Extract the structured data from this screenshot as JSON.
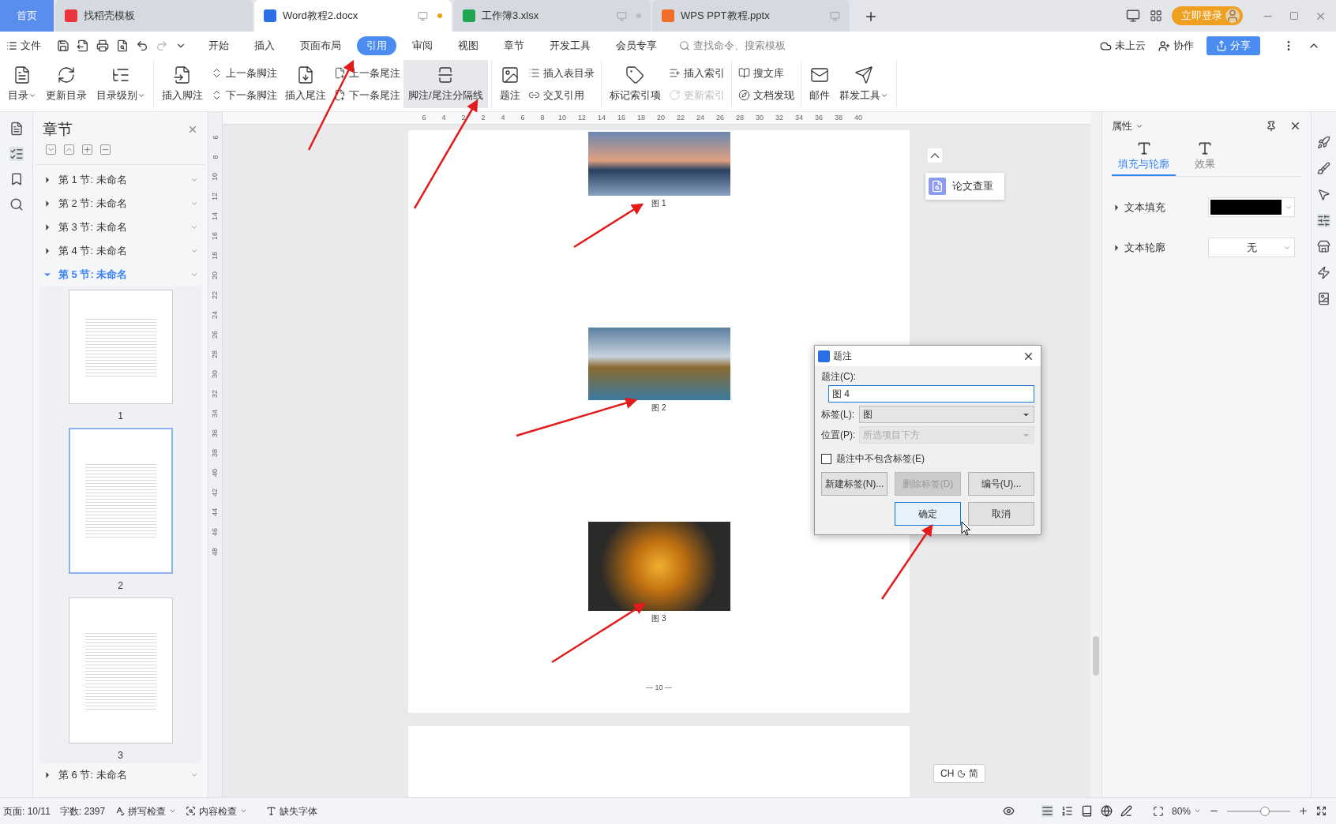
{
  "window_tabs": [
    {
      "label": "首页",
      "kind": "home",
      "selected": false
    },
    {
      "label": "找稻壳模板",
      "kind": "docer",
      "selected": false
    },
    {
      "label": "Word教程2.docx",
      "kind": "word",
      "selected": true
    },
    {
      "label": "工作簿3.xlsx",
      "kind": "excel",
      "selected": false
    },
    {
      "label": "WPS PPT教程.pptx",
      "kind": "ppt",
      "selected": false
    }
  ],
  "login_button": "立即登录",
  "menu": {
    "file": "文件",
    "search_placeholder": "查找命令、搜索模板",
    "cloud": "未上云",
    "collab": "协作",
    "share": "分享",
    "tabs": [
      {
        "label": "开始",
        "selected": false
      },
      {
        "label": "插入",
        "selected": false
      },
      {
        "label": "页面布局",
        "selected": false
      },
      {
        "label": "引用",
        "selected": true
      },
      {
        "label": "审阅",
        "selected": false
      },
      {
        "label": "视图",
        "selected": false
      },
      {
        "label": "章节",
        "selected": false
      },
      {
        "label": "开发工具",
        "selected": false
      },
      {
        "label": "会员专享",
        "selected": false
      }
    ]
  },
  "ribbon": [
    [
      {
        "kind": "large",
        "label": "目录",
        "dropdown": true,
        "highlighted": false
      },
      {
        "kind": "large",
        "label": "更新目录",
        "dropdown": false,
        "highlighted": false
      },
      {
        "kind": "large",
        "label": "目录级别",
        "dropdown": true,
        "highlighted": false
      }
    ],
    [
      {
        "kind": "large",
        "label": "插入脚注",
        "dropdown": false,
        "highlighted": false
      },
      {
        "kind": "pair",
        "items": [
          {
            "label": "上一条脚注",
            "disabled": false
          },
          {
            "label": "下一条脚注",
            "disabled": false
          }
        ]
      },
      {
        "kind": "large",
        "label": "插入尾注",
        "dropdown": false,
        "highlighted": false
      },
      {
        "kind": "pair",
        "items": [
          {
            "label": "上一条尾注",
            "disabled": false
          },
          {
            "label": "下一条尾注",
            "disabled": false
          }
        ]
      },
      {
        "kind": "large",
        "label": "脚注/尾注分隔线",
        "dropdown": false,
        "highlighted": true
      }
    ],
    [
      {
        "kind": "large",
        "label": "题注",
        "dropdown": false,
        "highlighted": false
      },
      {
        "kind": "pair",
        "items": [
          {
            "label": "插入表目录",
            "disabled": false
          },
          {
            "label": "交叉引用",
            "disabled": false
          }
        ]
      }
    ],
    [
      {
        "kind": "large",
        "label": "标记索引项",
        "dropdown": false,
        "highlighted": false
      },
      {
        "kind": "pair",
        "items": [
          {
            "label": "插入索引",
            "disabled": false
          },
          {
            "label": "更新索引",
            "disabled": true
          }
        ]
      }
    ],
    [
      {
        "kind": "pair",
        "items": [
          {
            "label": "搜文库",
            "disabled": false
          },
          {
            "label": "文档发现",
            "disabled": false
          }
        ]
      }
    ],
    [
      {
        "kind": "large",
        "label": "邮件",
        "dropdown": false,
        "highlighted": false
      },
      {
        "kind": "large",
        "label": "群发工具",
        "dropdown": true,
        "highlighted": false
      }
    ]
  ],
  "chapter_panel": {
    "title": "章节",
    "sections": [
      {
        "label": "第 1 节: 未命名",
        "expanded": false,
        "selected": false
      },
      {
        "label": "第 2 节: 未命名",
        "expanded": false,
        "selected": false
      },
      {
        "label": "第 3 节: 未命名",
        "expanded": false,
        "selected": false
      },
      {
        "label": "第 4 节: 未命名",
        "expanded": false,
        "selected": false
      },
      {
        "label": "第 5 节: 未命名",
        "expanded": true,
        "selected": true,
        "pages": [
          {
            "number": "1",
            "selected": false
          },
          {
            "number": "2",
            "selected": true
          },
          {
            "number": "3",
            "selected": false
          }
        ]
      },
      {
        "label": "第 6 节: 未命名",
        "expanded": false,
        "selected": false
      }
    ]
  },
  "rulers": {
    "horizontal": [
      "6",
      "4",
      "2",
      "2",
      "4",
      "6",
      "8",
      "10",
      "12",
      "14",
      "16",
      "18",
      "20",
      "22",
      "24",
      "26",
      "28",
      "30",
      "32",
      "34",
      "36",
      "38",
      "40"
    ],
    "vertical": [
      "6",
      "8",
      "10",
      "12",
      "14",
      "16",
      "18",
      "20",
      "22",
      "24",
      "26",
      "28",
      "30",
      "32",
      "34",
      "36",
      "38",
      "40",
      "42",
      "44",
      "46",
      "48"
    ]
  },
  "document": {
    "figures": [
      {
        "caption": "图 1"
      },
      {
        "caption": "图 2"
      },
      {
        "caption": "图 3"
      }
    ],
    "page_number": "— 10 —"
  },
  "floating_button": "论文查重",
  "ime": {
    "language": "CH",
    "mode": "简"
  },
  "properties_panel": {
    "title": "属性",
    "tabs": [
      {
        "label": "填充与轮廓",
        "selected": true
      },
      {
        "label": "效果",
        "selected": false
      }
    ],
    "rows": [
      {
        "label": "文本填充",
        "kind": "color",
        "color": "#000000"
      },
      {
        "label": "文本轮廓",
        "kind": "select",
        "value": "无"
      }
    ]
  },
  "dialog": {
    "title": "题注",
    "caption_label": "题注(C):",
    "caption_value": "图 4",
    "fields": [
      {
        "label": "标签(L):",
        "value": "图",
        "disabled": false
      },
      {
        "label": "位置(P):",
        "value": "所选项目下方",
        "disabled": true
      }
    ],
    "checkbox": {
      "label": "题注中不包含标签(E)",
      "checked": false
    },
    "buttons": [
      {
        "label": "新建标签(N)...",
        "disabled": false,
        "default": false
      },
      {
        "label": "删除标签(D)",
        "disabled": true,
        "default": false
      },
      {
        "label": "编号(U)...",
        "disabled": false,
        "default": false
      },
      {
        "label": "确定",
        "disabled": false,
        "default": true
      },
      {
        "label": "取消",
        "disabled": false,
        "default": false
      }
    ]
  },
  "status_bar": {
    "page": "页面: 10/11",
    "words": "字数: 2397",
    "tools": [
      "拼写检查",
      "内容检查"
    ],
    "missing_font": "缺失字体",
    "zoom": "80%",
    "zoom_slider": {
      "level": 0.6
    }
  }
}
